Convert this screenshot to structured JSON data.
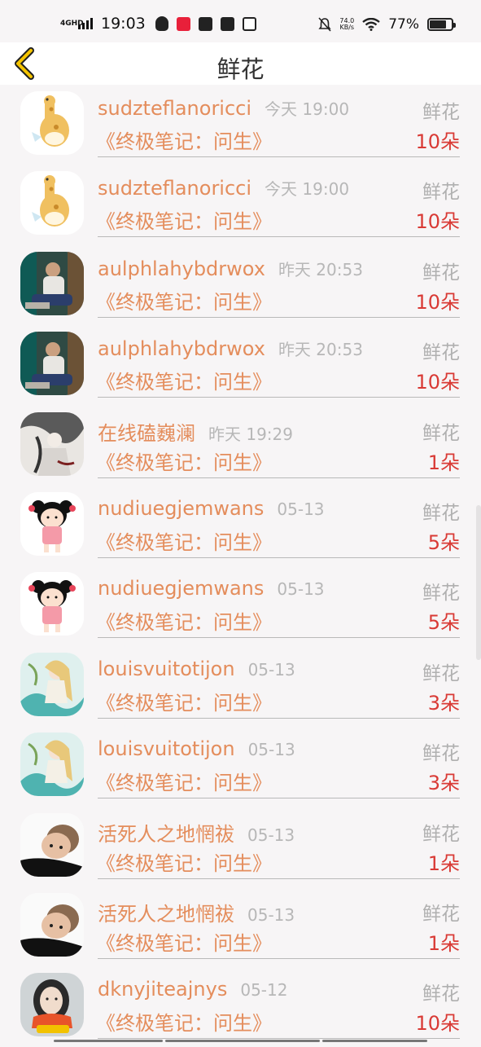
{
  "status_bar": {
    "network": "4GHD",
    "time": "19:03",
    "app_icon_red_label": "小红书",
    "app_icon_box_label": "哇",
    "speed_value": "74.0",
    "speed_unit": "KB/s",
    "battery": "77%",
    "battery_level": 0.77
  },
  "nav": {
    "title": "鲜花",
    "back_color": "#f5c400"
  },
  "colors": {
    "name": "#e48d5c",
    "time": "#b7b7b7",
    "count": "#d93a35",
    "gift_type": "#b0b0b0"
  },
  "records": [
    {
      "name": "sudzteflanoricci",
      "time": "今天 19:00",
      "gift": "鲜花",
      "subject": "《终极笔记：问生》",
      "count": "10朵",
      "avatar": "giraffe-icon"
    },
    {
      "name": "sudzteflanoricci",
      "time": "今天 19:00",
      "gift": "鲜花",
      "subject": "《终极笔记：问生》",
      "count": "10朵",
      "avatar": "giraffe-icon"
    },
    {
      "name": "aulphlahybdrwox",
      "time": "昨天 20:53",
      "gift": "鲜花",
      "subject": "《终极笔记：问生》",
      "count": "10朵",
      "avatar": "man-photo"
    },
    {
      "name": "aulphlahybdrwox",
      "time": "昨天 20:53",
      "gift": "鲜花",
      "subject": "《终极笔记：问生》",
      "count": "10朵",
      "avatar": "man-photo"
    },
    {
      "name": "在线磕巍澜",
      "time": "昨天 19:29",
      "gift": "鲜花",
      "subject": "《终极笔记：问生》",
      "count": "1朵",
      "avatar": "ink-art"
    },
    {
      "name": "nudiuegjemwans",
      "time": "05-13",
      "gift": "鲜花",
      "subject": "《终极笔记：问生》",
      "count": "5朵",
      "avatar": "girl-cartoon"
    },
    {
      "name": "nudiuegjemwans",
      "time": "05-13",
      "gift": "鲜花",
      "subject": "《终极笔记：问生》",
      "count": "5朵",
      "avatar": "girl-cartoon"
    },
    {
      "name": "louisvuitotijon",
      "time": "05-13",
      "gift": "鲜花",
      "subject": "《终极笔记：问生》",
      "count": "3朵",
      "avatar": "anime-art"
    },
    {
      "name": "louisvuitotijon",
      "time": "05-13",
      "gift": "鲜花",
      "subject": "《终极笔记：问生》",
      "count": "3朵",
      "avatar": "anime-art"
    },
    {
      "name": "活死人之地惘祓",
      "time": "05-13",
      "gift": "鲜花",
      "subject": "《终极笔记：问生》",
      "count": "1朵",
      "avatar": "child-photo"
    },
    {
      "name": "活死人之地惘祓",
      "time": "05-13",
      "gift": "鲜花",
      "subject": "《终极笔记：问生》",
      "count": "1朵",
      "avatar": "child-photo"
    },
    {
      "name": "dknyjiteajnys",
      "time": "05-12",
      "gift": "鲜花",
      "subject": "《终极笔记：问生》",
      "count": "10朵",
      "avatar": "woman-photo"
    }
  ]
}
